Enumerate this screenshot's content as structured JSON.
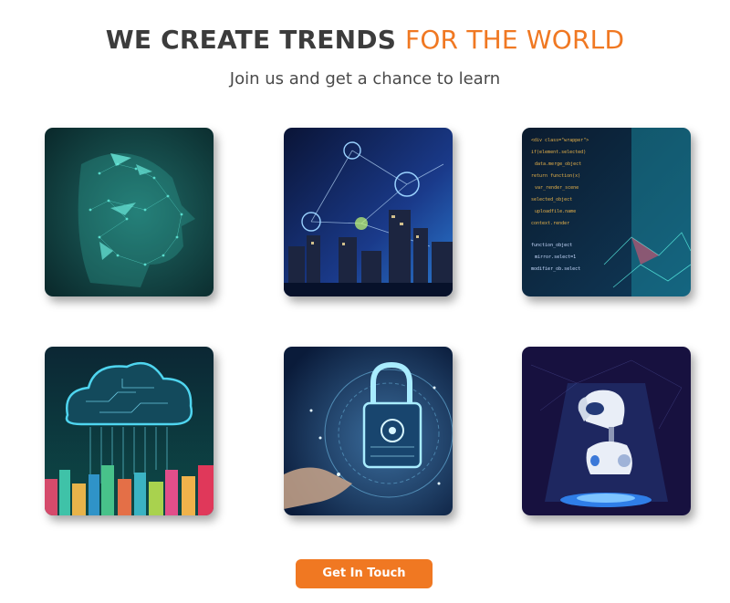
{
  "hero": {
    "title_main": "WE CREATE TRENDS",
    "title_accent": "FOR THE WORLD",
    "subtitle": "Join us and get a chance to learn"
  },
  "gallery": {
    "tiles": [
      {
        "subject": "ai-face-network"
      },
      {
        "subject": "smart-city-wifi"
      },
      {
        "subject": "code-screen"
      },
      {
        "subject": "cloud-circuit-city"
      },
      {
        "subject": "cyber-lock-hand"
      },
      {
        "subject": "robot-hologram"
      }
    ]
  },
  "cta": {
    "label": "Get In Touch"
  },
  "colors": {
    "accent": "#f07822",
    "text_dark": "#3c3c3c"
  }
}
